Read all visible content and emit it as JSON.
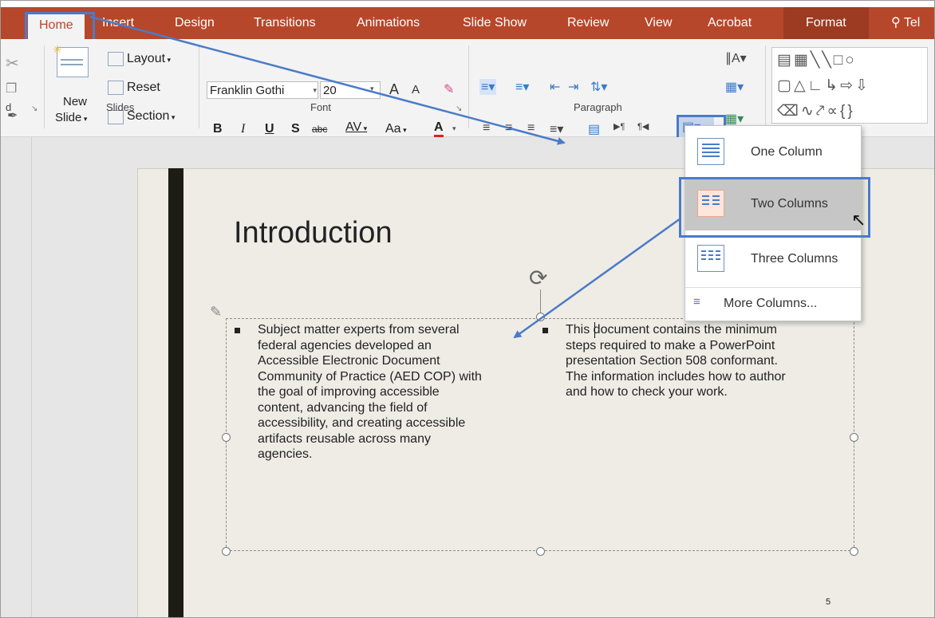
{
  "tabs": [
    "Home",
    "Insert",
    "Design",
    "Transitions",
    "Animations",
    "Slide Show",
    "Review",
    "View",
    "Acrobat",
    "Format",
    "Tel"
  ],
  "ribbon": {
    "slides": {
      "new_slide_line1": "New",
      "new_slide_line2": "Slide",
      "layout": "Layout",
      "reset": "Reset",
      "section": "Section",
      "group_label": "Slides"
    },
    "font": {
      "font_name": "Franklin Gothi",
      "font_size": "20",
      "bold": "B",
      "italic": "I",
      "underline": "U",
      "shadow": "S",
      "strikethrough": "abc",
      "spacing": "AV",
      "change_case": "Aa",
      "font_color": "A",
      "grow": "A",
      "shrink": "A",
      "group_label": "Font"
    },
    "paragraph": {
      "group_label": "Paragraph"
    },
    "clipboard_partial_label": "d"
  },
  "slide": {
    "title": "Introduction",
    "col1": [
      "Subject matter experts from several",
      "federal agencies developed an",
      "Accessible Electronic Document",
      "Community of Practice (AED COP) with",
      "the goal of improving accessible",
      "content, advancing the field of",
      "accessibility, and creating accessible",
      "artifacts reusable across many",
      "agencies."
    ],
    "col2": [
      "This document contains the minimum",
      "steps required to make a PowerPoint",
      "presentation Section 508 conformant.",
      "The information includes how to author",
      "and how to check your work."
    ],
    "page_number": "5"
  },
  "columns_menu": {
    "items": [
      "One Column",
      "Two Columns",
      "Three Columns"
    ],
    "more": "More Columns...",
    "selected": "Two Columns"
  },
  "colors": {
    "tab_bar": "#b7472a",
    "format_tab": "#9c3b22",
    "highlight": "#4a7bc8",
    "hover": "#c6c6c6"
  }
}
